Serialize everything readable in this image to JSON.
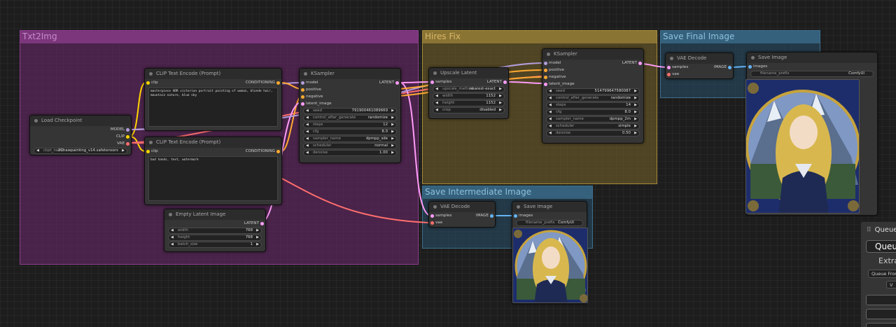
{
  "groups": {
    "txt2img": "Txt2Img",
    "hires": "Hires Fix",
    "save_final": "Save Final Image",
    "save_intermediate": "Save Intermediate Image"
  },
  "load_checkpoint": {
    "title": "Load Checkpoint",
    "outputs": [
      "MODEL",
      "CLIP",
      "VAE"
    ],
    "ckpt_label": "ckpt_name",
    "ckpt_value": "2Chawpainting_v14.safetensors"
  },
  "clip_pos": {
    "title": "CLIP Text Encode (Prompt)",
    "input": "clip",
    "output": "CONDITIONING",
    "text": "masterpiece HDR victorian portrait painting of woman, blonde hair, mountain nature, blue sky"
  },
  "clip_neg": {
    "title": "CLIP Text Encode (Prompt)",
    "input": "clip",
    "output": "CONDITIONING",
    "text": "bad hands, text, watermark"
  },
  "empty_latent": {
    "title": "Empty Latent Image",
    "output": "LATENT",
    "widgets": [
      {
        "label": "width",
        "value": "768"
      },
      {
        "label": "height",
        "value": "768"
      },
      {
        "label": "batch_size",
        "value": "1"
      }
    ]
  },
  "ksampler1": {
    "title": "KSampler",
    "inputs": [
      "model",
      "positive",
      "negative",
      "latent_image"
    ],
    "output": "LATENT",
    "widgets": [
      {
        "label": "seed",
        "value": "791900461089669"
      },
      {
        "label": "control_after_generate",
        "value": "randomize"
      },
      {
        "label": "steps",
        "value": "12"
      },
      {
        "label": "cfg",
        "value": "8.0"
      },
      {
        "label": "sampler_name",
        "value": "dpmpp_sde"
      },
      {
        "label": "scheduler",
        "value": "normal"
      },
      {
        "label": "denoise",
        "value": "1.00"
      }
    ]
  },
  "upscale": {
    "title": "Upscale Latent",
    "input": "samples",
    "output": "LATENT",
    "widgets": [
      {
        "label": "upscale_method",
        "value": "nearest-exact"
      },
      {
        "label": "width",
        "value": "1152"
      },
      {
        "label": "height",
        "value": "1152"
      },
      {
        "label": "crop",
        "value": "disabled"
      }
    ]
  },
  "ksampler2": {
    "title": "KSampler",
    "inputs": [
      "model",
      "positive",
      "negative",
      "latent_image"
    ],
    "output": "LATENT",
    "widgets": [
      {
        "label": "seed",
        "value": "514799647580087"
      },
      {
        "label": "control_after_generate",
        "value": "randomize"
      },
      {
        "label": "steps",
        "value": "14"
      },
      {
        "label": "cfg",
        "value": "8.0"
      },
      {
        "label": "sampler_name",
        "value": "dpmpp_2m"
      },
      {
        "label": "scheduler",
        "value": "simple"
      },
      {
        "label": "denoise",
        "value": "0.50"
      }
    ]
  },
  "vae_decode_final": {
    "title": "VAE Decode",
    "inputs": [
      "samples",
      "vae"
    ],
    "output": "IMAGE"
  },
  "save_final": {
    "title": "Save Image",
    "input": "images",
    "prefix_label": "filename_prefix",
    "prefix_value": "ComfyUI"
  },
  "vae_decode_inter": {
    "title": "VAE Decode",
    "inputs": [
      "samples",
      "vae"
    ],
    "output": "IMAGE"
  },
  "save_inter": {
    "title": "Save Image",
    "input": "images",
    "prefix_label": "filename_prefix",
    "prefix_value": "ComfyUI"
  },
  "queue_panel": {
    "title": "Queue",
    "queue_button": "Queue",
    "extra": "Extra",
    "queue_front": "Queue Front",
    "view": "V"
  },
  "colors": {
    "model": "#b39ddb",
    "clip": "#ffd500",
    "vae": "#ff6e6e",
    "conditioning": "#ffa931",
    "latent": "#ff9cf9",
    "image": "#64b5f6"
  }
}
